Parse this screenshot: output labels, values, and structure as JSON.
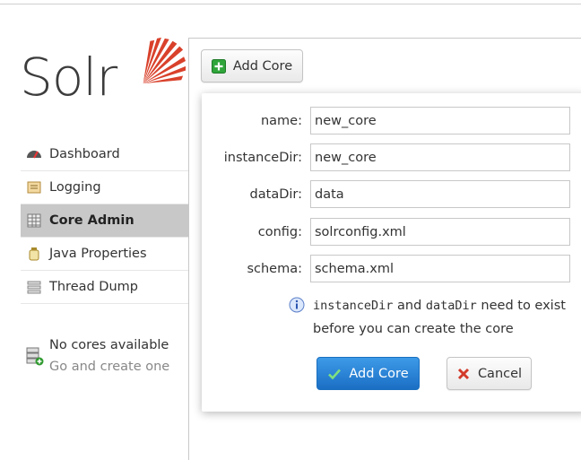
{
  "logo": {
    "text": "Solr"
  },
  "nav": {
    "items": [
      {
        "label": "Dashboard",
        "icon": "dashboard-icon"
      },
      {
        "label": "Logging",
        "icon": "logging-icon"
      },
      {
        "label": "Core Admin",
        "icon": "core-admin-icon",
        "active": true
      },
      {
        "label": "Java Properties",
        "icon": "java-icon"
      },
      {
        "label": "Thread Dump",
        "icon": "thread-dump-icon"
      }
    ]
  },
  "cores": {
    "title": "No cores available",
    "subtitle": "Go and create one"
  },
  "toolbar": {
    "add_core_label": "Add Core"
  },
  "form": {
    "name_label": "name:",
    "name_value": "new_core",
    "instancedir_label": "instanceDir:",
    "instancedir_value": "new_core",
    "datadir_label": "dataDir:",
    "datadir_value": "data",
    "config_label": "config:",
    "config_value": "solrconfig.xml",
    "schema_label": "schema:",
    "schema_value": "schema.xml",
    "hint_code1": "instanceDir",
    "hint_and": " and ",
    "hint_code2": "dataDir",
    "hint_rest": " need to exist before you can create the core",
    "submit_label": "Add Core",
    "cancel_label": "Cancel"
  },
  "colors": {
    "primary": "#1b6fc4",
    "logo_burst": "#d9412b",
    "active_nav": "#c8c8c8"
  }
}
